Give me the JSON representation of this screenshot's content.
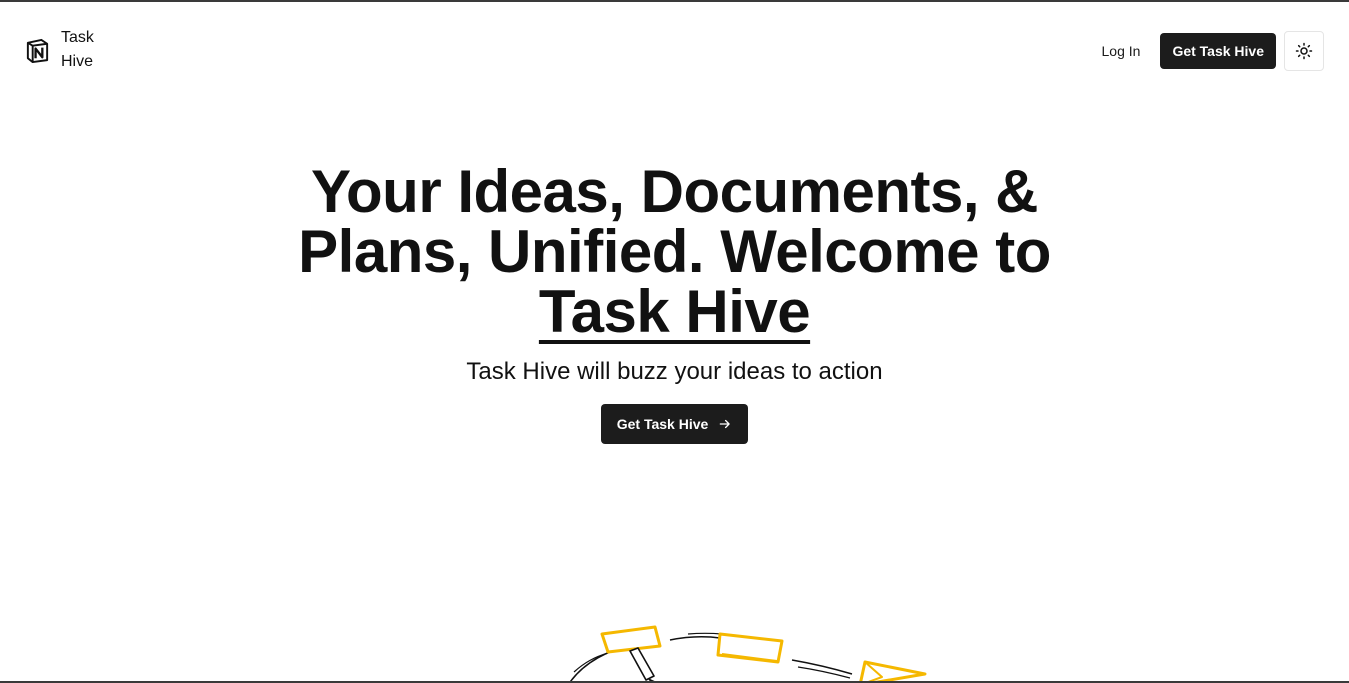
{
  "nav": {
    "logo_icon": "notion-style-n-logo",
    "brand_name": "Task Hive",
    "login_label": "Log In",
    "cta_label": "Get Task Hive",
    "theme_icon": "sun-icon"
  },
  "hero": {
    "headline": "Your Ideas, Documents, & Plans, Unified. Welcome to",
    "brand": "Task Hive",
    "tagline": "Task Hive will buzz your ideas to action",
    "cta_label": "Get Task Hive",
    "cta_icon": "arrow-right-icon"
  },
  "colors": {
    "primary": "#1c1c1c",
    "background": "#ffffff",
    "accent_yellow": "#f5b800"
  }
}
